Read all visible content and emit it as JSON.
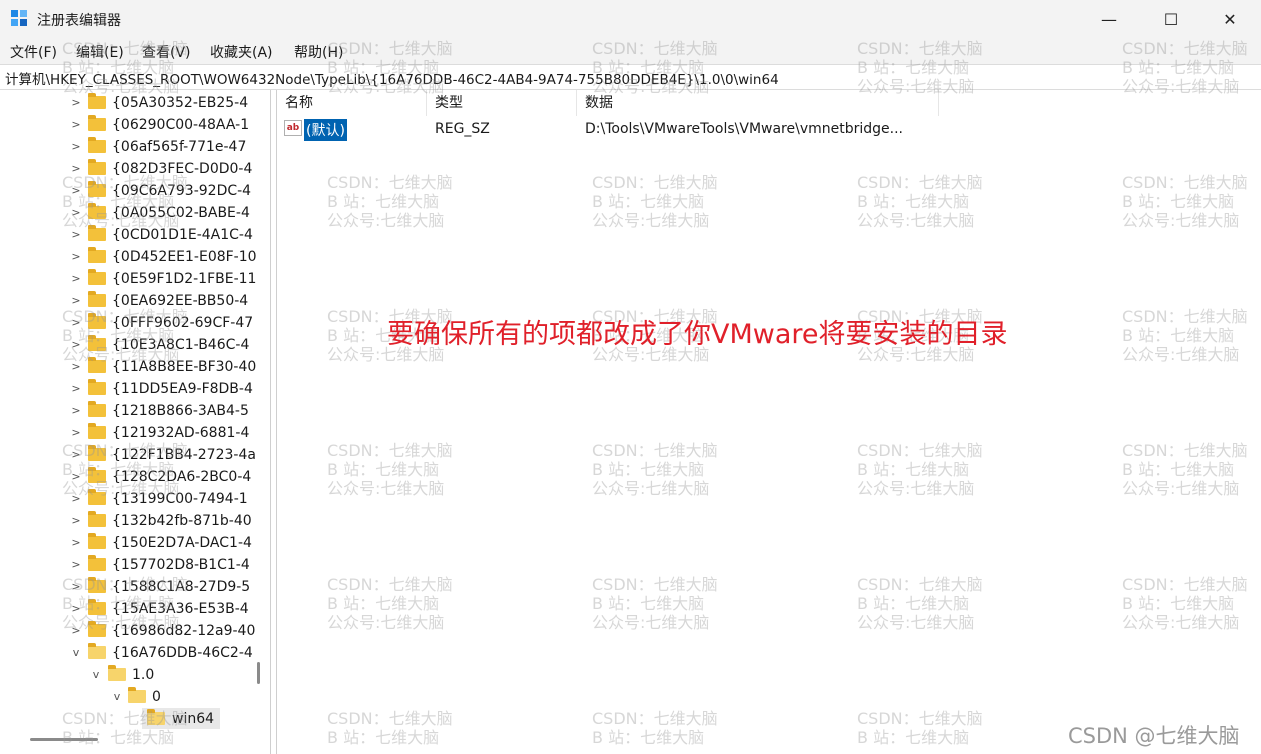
{
  "window": {
    "title": "注册表编辑器",
    "controls": {
      "minimize": "—",
      "maximize": "☐",
      "close": "✕"
    }
  },
  "menu": [
    "文件(F)",
    "编辑(E)",
    "查看(V)",
    "收藏夹(A)",
    "帮助(H)"
  ],
  "address": "计算机\\HKEY_CLASSES_ROOT\\WOW6432Node\\TypeLib\\{16A76DDB-46C2-4AB4-9A74-755B80DDEB4E}\\1.0\\0\\win64",
  "tree": {
    "items": [
      "{05A30352-EB25-4",
      "{06290C00-48AA-1",
      "{06af565f-771e-47",
      "{082D3FEC-D0D0-4",
      "{09C6A793-92DC-4",
      "{0A055C02-BABE-4",
      "{0CD01D1E-4A1C-4",
      "{0D452EE1-E08F-10",
      "{0E59F1D2-1FBE-11",
      "{0EA692EE-BB50-4",
      "{0FFF9602-69CF-47",
      "{10E3A8C1-B46C-4",
      "{11A8B8EE-BF30-40",
      "{11DD5EA9-F8DB-4",
      "{1218B866-3AB4-5",
      "{121932AD-6881-4",
      "{122F1BB4-2723-4a",
      "{128C2DA6-2BC0-4",
      "{13199C00-7494-1",
      "{132b42fb-871b-40",
      "{150E2D7A-DAC1-4",
      "{157702D8-B1C1-4",
      "{1588C1A8-27D9-5",
      "{15AE3A36-E53B-4",
      "{16986d82-12a9-40",
      "{16A76DDB-46C2-4"
    ],
    "sub_1": "1.0",
    "sub_2": "0",
    "selected": "win64"
  },
  "columns": {
    "name": "名称",
    "type": "类型",
    "data": "数据"
  },
  "values": [
    {
      "icon": "ab",
      "name": "(默认)",
      "type": "REG_SZ",
      "data": "D:\\Tools\\VMwareTools\\VMware\\vmnetbridge..."
    }
  ],
  "annotation": "要确保所有的项都改成了你VMware将要安装的目录",
  "watermark": {
    "line1": "CSDN：七维大脑",
    "line2": "B 站：七维大脑",
    "line3": "公众号:七维大脑"
  },
  "corner_watermark": "CSDN @七维大脑"
}
